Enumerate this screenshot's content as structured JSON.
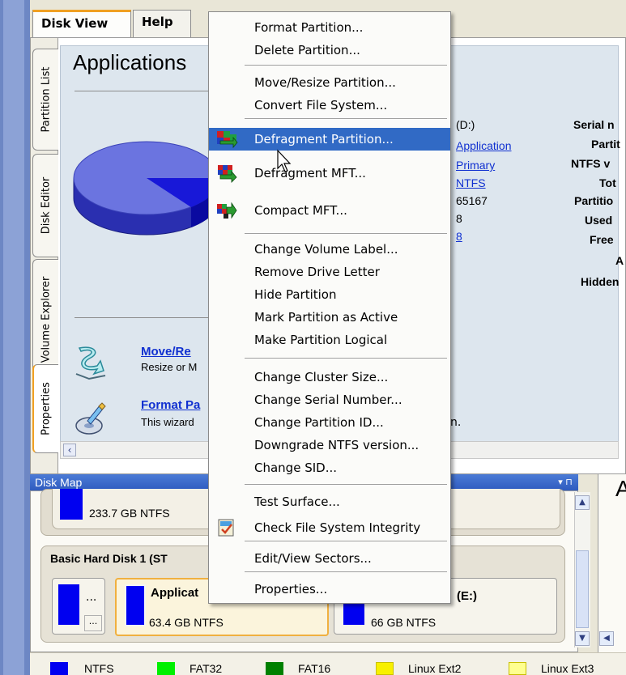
{
  "tabs": {
    "disk_view": "Disk View",
    "help": "Help"
  },
  "vertical_tabs": [
    "Partition List",
    "Disk Editor",
    "Volume Explorer",
    "Properties"
  ],
  "content": {
    "title": "Applications",
    "info_values": [
      {
        "text": "(D:)",
        "link": false
      },
      {
        "text": "Application",
        "link": true
      },
      {
        "text": "Primary",
        "link": true
      },
      {
        "text": "NTFS",
        "link": true
      },
      {
        "text": "65167",
        "link": false
      },
      {
        "text": "8",
        "link": false
      },
      {
        "text": "8",
        "link": true
      }
    ],
    "info_keys": [
      "Serial n",
      "Partit",
      "NTFS v",
      "Tot",
      "Partitio",
      "Used",
      "Free",
      "A",
      "Hidden"
    ],
    "actions": [
      {
        "title": "Move/Re",
        "desc": "Resize or M"
      },
      {
        "title": "Format Pa",
        "desc": "This wizard"
      }
    ],
    "stray_text": "n."
  },
  "disk_map": {
    "header": "Disk Map",
    "disk0_size": "233.7 GB NTFS",
    "disk1_label": "Basic Hard Disk 1 (ST",
    "small_partition_dots": "...",
    "app_partition_name": "Applicat",
    "app_partition_size": "63.4 GB NTFS",
    "e_partition_name": "(E:)",
    "e_partition_size": "66 GB NTFS",
    "right_panel_letter": "A"
  },
  "legend": [
    {
      "label": "NTFS",
      "color": "#0000f0"
    },
    {
      "label": "FAT32",
      "color": "#00f000"
    },
    {
      "label": "FAT16",
      "color": "#008000"
    },
    {
      "label": "Linux Ext2",
      "color": "#f8f000"
    },
    {
      "label": "Linux Ext3",
      "color": "#ffff90"
    }
  ],
  "context_menu": {
    "items": [
      {
        "label": "Format Partition...",
        "icon": null
      },
      {
        "label": "Delete Partition...",
        "icon": null
      },
      {
        "label": "Move/Resize Partition...",
        "icon": null
      },
      {
        "label": "Convert File System...",
        "icon": null
      },
      {
        "label": "Defragment Partition...",
        "icon": "defragment-partition-icon",
        "highlighted": true
      },
      {
        "label": "Defragment MFT...",
        "icon": "defragment-mft-icon"
      },
      {
        "label": "Compact MFT...",
        "icon": "compact-mft-icon"
      },
      {
        "label": "Change Volume Label...",
        "icon": null
      },
      {
        "label": "Remove Drive Letter",
        "icon": null
      },
      {
        "label": "Hide Partition",
        "icon": null
      },
      {
        "label": "Mark Partition as Active",
        "icon": null
      },
      {
        "label": "Make Partition Logical",
        "icon": null
      },
      {
        "label": "Change Cluster Size...",
        "icon": null
      },
      {
        "label": "Change Serial Number...",
        "icon": null
      },
      {
        "label": "Change Partition ID...",
        "icon": null
      },
      {
        "label": "Downgrade NTFS version...",
        "icon": null
      },
      {
        "label": "Change SID...",
        "icon": null
      },
      {
        "label": "Test Surface...",
        "icon": null
      },
      {
        "label": "Check File System Integrity",
        "icon": "check-file-system-icon"
      },
      {
        "label": "Edit/View Sectors...",
        "icon": null
      },
      {
        "label": "Properties...",
        "icon": null
      }
    ]
  }
}
